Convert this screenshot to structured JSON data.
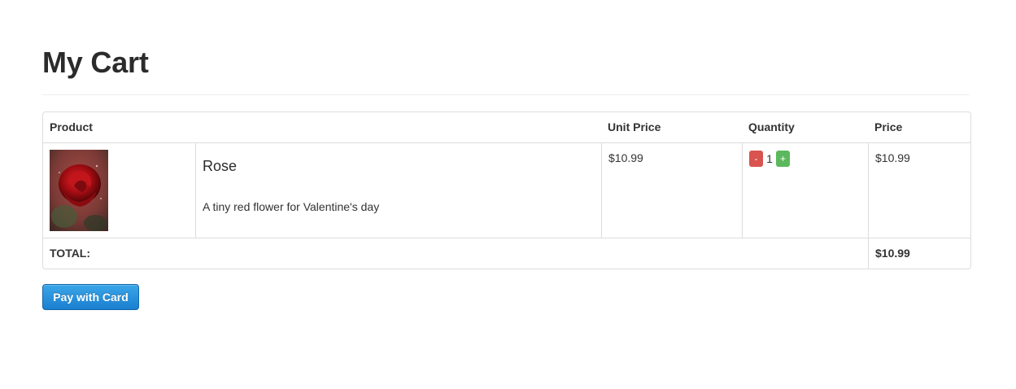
{
  "page": {
    "title": "My Cart"
  },
  "table": {
    "headers": {
      "product": "Product",
      "unit_price": "Unit Price",
      "quantity": "Quantity",
      "price": "Price"
    },
    "items": [
      {
        "name": "Rose",
        "description": "A tiny red flower for Valentine's day",
        "image": "rose-image",
        "unit_price": "$10.99",
        "quantity": "1",
        "decrement_label": "-",
        "increment_label": "+",
        "price": "$10.99"
      }
    ],
    "footer": {
      "total_label": "TOTAL:",
      "total_value": "$10.99"
    }
  },
  "actions": {
    "pay_label": "Pay with Card"
  },
  "colors": {
    "pay_button": "#1a7fd0",
    "decrement_button": "#d9534f",
    "increment_button": "#5cb85c"
  }
}
